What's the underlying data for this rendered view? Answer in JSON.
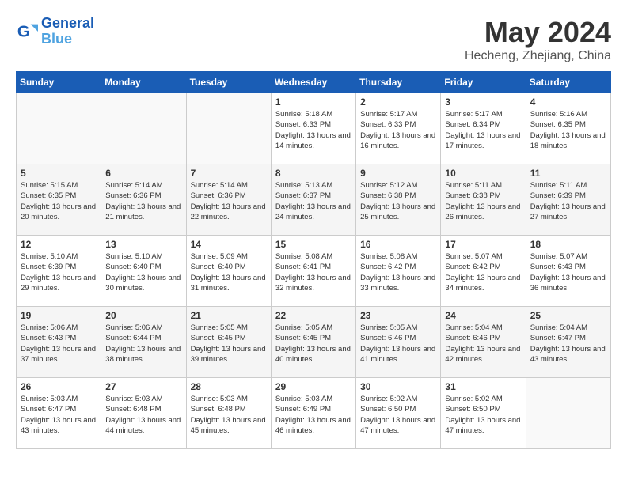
{
  "header": {
    "logo_line1": "General",
    "logo_line2": "Blue",
    "title": "May 2024",
    "subtitle": "Hecheng, Zhejiang, China"
  },
  "weekdays": [
    "Sunday",
    "Monday",
    "Tuesday",
    "Wednesday",
    "Thursday",
    "Friday",
    "Saturday"
  ],
  "weeks": [
    [
      {
        "day": "",
        "info": ""
      },
      {
        "day": "",
        "info": ""
      },
      {
        "day": "",
        "info": ""
      },
      {
        "day": "1",
        "info": "Sunrise: 5:18 AM\nSunset: 6:33 PM\nDaylight: 13 hours\nand 14 minutes."
      },
      {
        "day": "2",
        "info": "Sunrise: 5:17 AM\nSunset: 6:33 PM\nDaylight: 13 hours\nand 16 minutes."
      },
      {
        "day": "3",
        "info": "Sunrise: 5:17 AM\nSunset: 6:34 PM\nDaylight: 13 hours\nand 17 minutes."
      },
      {
        "day": "4",
        "info": "Sunrise: 5:16 AM\nSunset: 6:35 PM\nDaylight: 13 hours\nand 18 minutes."
      }
    ],
    [
      {
        "day": "5",
        "info": "Sunrise: 5:15 AM\nSunset: 6:35 PM\nDaylight: 13 hours\nand 20 minutes."
      },
      {
        "day": "6",
        "info": "Sunrise: 5:14 AM\nSunset: 6:36 PM\nDaylight: 13 hours\nand 21 minutes."
      },
      {
        "day": "7",
        "info": "Sunrise: 5:14 AM\nSunset: 6:36 PM\nDaylight: 13 hours\nand 22 minutes."
      },
      {
        "day": "8",
        "info": "Sunrise: 5:13 AM\nSunset: 6:37 PM\nDaylight: 13 hours\nand 24 minutes."
      },
      {
        "day": "9",
        "info": "Sunrise: 5:12 AM\nSunset: 6:38 PM\nDaylight: 13 hours\nand 25 minutes."
      },
      {
        "day": "10",
        "info": "Sunrise: 5:11 AM\nSunset: 6:38 PM\nDaylight: 13 hours\nand 26 minutes."
      },
      {
        "day": "11",
        "info": "Sunrise: 5:11 AM\nSunset: 6:39 PM\nDaylight: 13 hours\nand 27 minutes."
      }
    ],
    [
      {
        "day": "12",
        "info": "Sunrise: 5:10 AM\nSunset: 6:39 PM\nDaylight: 13 hours\nand 29 minutes."
      },
      {
        "day": "13",
        "info": "Sunrise: 5:10 AM\nSunset: 6:40 PM\nDaylight: 13 hours\nand 30 minutes."
      },
      {
        "day": "14",
        "info": "Sunrise: 5:09 AM\nSunset: 6:40 PM\nDaylight: 13 hours\nand 31 minutes."
      },
      {
        "day": "15",
        "info": "Sunrise: 5:08 AM\nSunset: 6:41 PM\nDaylight: 13 hours\nand 32 minutes."
      },
      {
        "day": "16",
        "info": "Sunrise: 5:08 AM\nSunset: 6:42 PM\nDaylight: 13 hours\nand 33 minutes."
      },
      {
        "day": "17",
        "info": "Sunrise: 5:07 AM\nSunset: 6:42 PM\nDaylight: 13 hours\nand 34 minutes."
      },
      {
        "day": "18",
        "info": "Sunrise: 5:07 AM\nSunset: 6:43 PM\nDaylight: 13 hours\nand 36 minutes."
      }
    ],
    [
      {
        "day": "19",
        "info": "Sunrise: 5:06 AM\nSunset: 6:43 PM\nDaylight: 13 hours\nand 37 minutes."
      },
      {
        "day": "20",
        "info": "Sunrise: 5:06 AM\nSunset: 6:44 PM\nDaylight: 13 hours\nand 38 minutes."
      },
      {
        "day": "21",
        "info": "Sunrise: 5:05 AM\nSunset: 6:45 PM\nDaylight: 13 hours\nand 39 minutes."
      },
      {
        "day": "22",
        "info": "Sunrise: 5:05 AM\nSunset: 6:45 PM\nDaylight: 13 hours\nand 40 minutes."
      },
      {
        "day": "23",
        "info": "Sunrise: 5:05 AM\nSunset: 6:46 PM\nDaylight: 13 hours\nand 41 minutes."
      },
      {
        "day": "24",
        "info": "Sunrise: 5:04 AM\nSunset: 6:46 PM\nDaylight: 13 hours\nand 42 minutes."
      },
      {
        "day": "25",
        "info": "Sunrise: 5:04 AM\nSunset: 6:47 PM\nDaylight: 13 hours\nand 43 minutes."
      }
    ],
    [
      {
        "day": "26",
        "info": "Sunrise: 5:03 AM\nSunset: 6:47 PM\nDaylight: 13 hours\nand 43 minutes."
      },
      {
        "day": "27",
        "info": "Sunrise: 5:03 AM\nSunset: 6:48 PM\nDaylight: 13 hours\nand 44 minutes."
      },
      {
        "day": "28",
        "info": "Sunrise: 5:03 AM\nSunset: 6:48 PM\nDaylight: 13 hours\nand 45 minutes."
      },
      {
        "day": "29",
        "info": "Sunrise: 5:03 AM\nSunset: 6:49 PM\nDaylight: 13 hours\nand 46 minutes."
      },
      {
        "day": "30",
        "info": "Sunrise: 5:02 AM\nSunset: 6:50 PM\nDaylight: 13 hours\nand 47 minutes."
      },
      {
        "day": "31",
        "info": "Sunrise: 5:02 AM\nSunset: 6:50 PM\nDaylight: 13 hours\nand 47 minutes."
      },
      {
        "day": "",
        "info": ""
      }
    ]
  ]
}
